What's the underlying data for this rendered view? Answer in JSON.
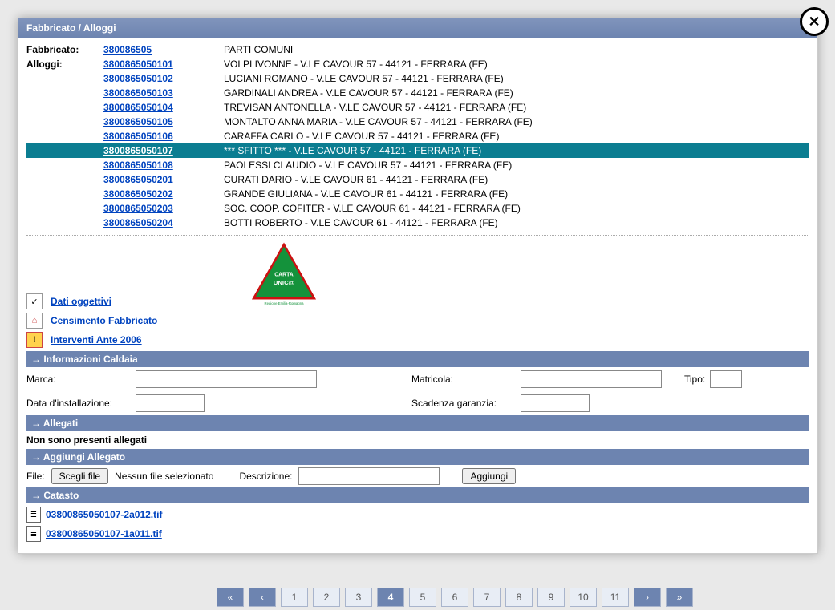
{
  "title": "Fabbricato / Alloggi",
  "labels": {
    "fabbricato": "Fabbricato:",
    "alloggi": "Alloggi:"
  },
  "fabbricato": {
    "code": "380086505",
    "desc": "PARTI COMUNI"
  },
  "alloggi": [
    {
      "code": "3800865050101",
      "desc": "VOLPI IVONNE - V.LE CAVOUR 57 - 44121 - FERRARA (FE)"
    },
    {
      "code": "3800865050102",
      "desc": "LUCIANI ROMANO - V.LE CAVOUR 57 - 44121 - FERRARA (FE)"
    },
    {
      "code": "3800865050103",
      "desc": "GARDINALI ANDREA - V.LE CAVOUR 57 - 44121 - FERRARA (FE)"
    },
    {
      "code": "3800865050104",
      "desc": "TREVISAN ANTONELLA - V.LE CAVOUR 57 - 44121 - FERRARA (FE)"
    },
    {
      "code": "3800865050105",
      "desc": "MONTALTO ANNA MARIA - V.LE CAVOUR 57 - 44121 - FERRARA (FE)"
    },
    {
      "code": "3800865050106",
      "desc": "CARAFFA CARLO - V.LE CAVOUR 57 - 44121 - FERRARA (FE)"
    },
    {
      "code": "3800865050107",
      "desc": "*** SFITTO *** - V.LE CAVOUR 57 - 44121 - FERRARA (FE)",
      "selected": true
    },
    {
      "code": "3800865050108",
      "desc": "PAOLESSI CLAUDIO - V.LE CAVOUR 57 - 44121 - FERRARA (FE)"
    },
    {
      "code": "3800865050201",
      "desc": "CURATI DARIO - V.LE CAVOUR 61 - 44121 - FERRARA (FE)"
    },
    {
      "code": "3800865050202",
      "desc": "GRANDE GIULIANA - V.LE CAVOUR 61 - 44121 - FERRARA (FE)"
    },
    {
      "code": "3800865050203",
      "desc": "SOC. COOP. COFITER - V.LE CAVOUR 61 - 44121 - FERRARA (FE)"
    },
    {
      "code": "3800865050204",
      "desc": "BOTTI ROBERTO - V.LE CAVOUR 61 - 44121 - FERRARA (FE)"
    }
  ],
  "actions": {
    "dati_oggettivi": "Dati oggettivi",
    "censimento": "Censimento Fabbricato",
    "interventi": "Interventi Ante 2006"
  },
  "sections": {
    "caldaia": "→ Informazioni Caldaia",
    "allegati": "→ Allegati",
    "aggiungi_allegato": "→ Aggiungi Allegato",
    "catasto": "→ Catasto"
  },
  "caldaia": {
    "marca_label": "Marca:",
    "matricola_label": "Matricola:",
    "tipo_label": "Tipo:",
    "data_inst_label": "Data d'installazione:",
    "scadenza_label": "Scadenza garanzia:",
    "marca": "",
    "matricola": "",
    "tipo": "",
    "data_inst": "",
    "scadenza": ""
  },
  "allegati_msg": "Non sono presenti allegati",
  "aggiungi": {
    "file_label": "File:",
    "scegli_file": "Scegli file",
    "no_file": "Nessun file selezionato",
    "descrizione_label": "Descrizione:",
    "descrizione": "",
    "aggiungi_btn": "Aggiungi"
  },
  "catasto_files": [
    "03800865050107-2a012.tif",
    "03800865050107-1a011.tif"
  ],
  "pager": {
    "first": "«",
    "prev": "‹",
    "next": "›",
    "last": "»",
    "pages": [
      "1",
      "2",
      "3",
      "4",
      "5",
      "6",
      "7",
      "8",
      "9",
      "10",
      "11"
    ],
    "active": "4"
  }
}
